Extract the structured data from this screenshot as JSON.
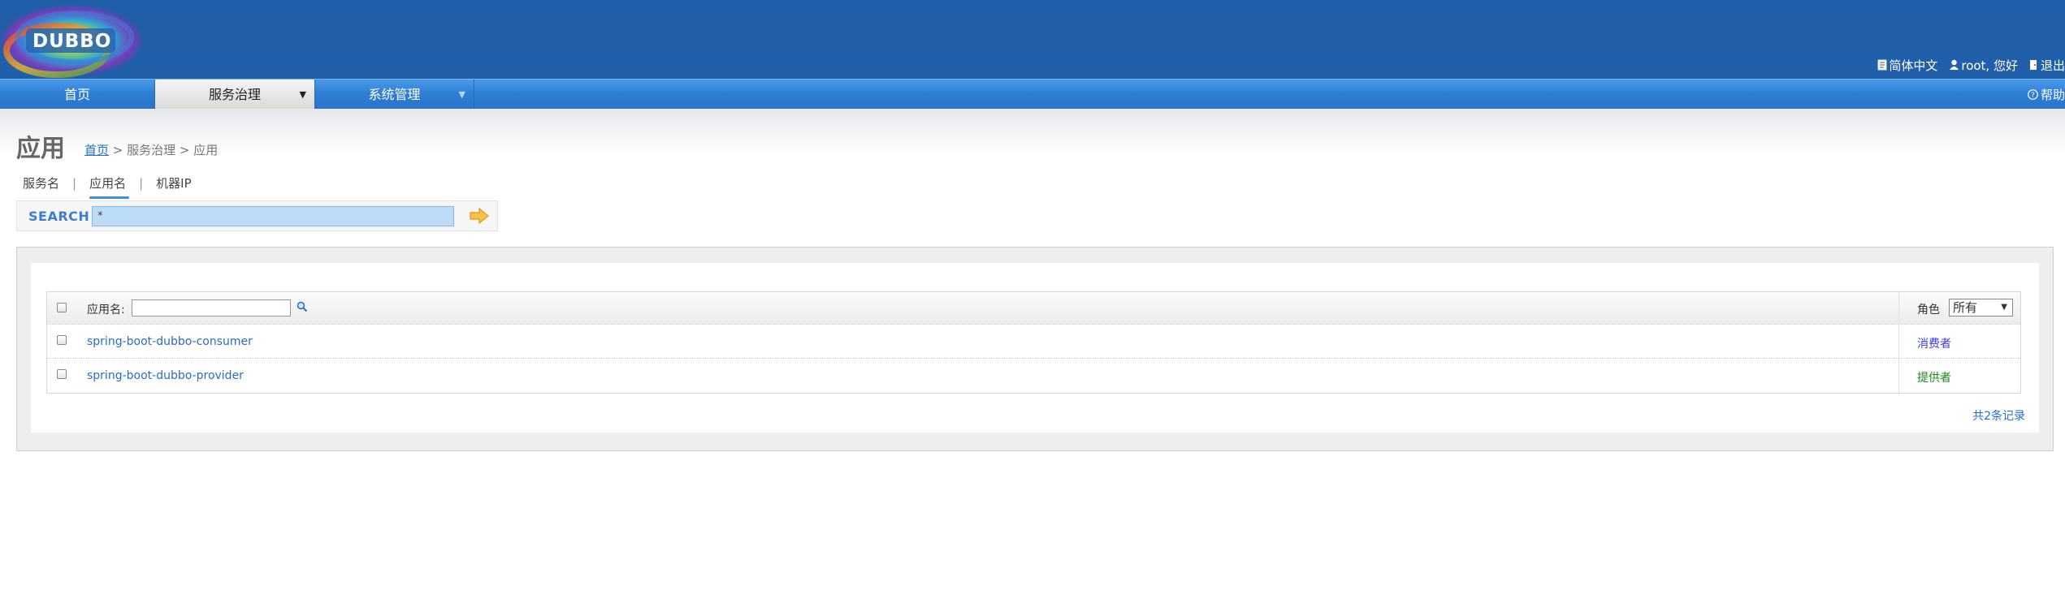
{
  "header": {
    "logo_text": "DUBBO",
    "top_links": [
      {
        "label": "简体中文",
        "icon": "document-icon"
      },
      {
        "label": "root, 您好",
        "icon": "user-icon"
      },
      {
        "label": "退出",
        "icon": "logout-icon"
      }
    ]
  },
  "menu": {
    "items": [
      {
        "label": "首页",
        "has_dropdown": false
      },
      {
        "label": "服务治理",
        "has_dropdown": true,
        "active": true
      },
      {
        "label": "系统管理",
        "has_dropdown": true
      }
    ],
    "dropdown_arrow": "▼",
    "help_label": "帮助",
    "help_icon": "help-icon"
  },
  "page": {
    "title": "应用",
    "breadcrumb": {
      "home": "首页",
      "trail": " > 服务治理 > 应用"
    }
  },
  "search": {
    "tabs": [
      "服务名",
      "应用名",
      "机器IP"
    ],
    "active_tab": 1,
    "label": "SEARCH",
    "value": "*",
    "go_icon": "arrow-right-icon"
  },
  "table": {
    "head_label": "应用名:",
    "filter_value": "",
    "filter_icon": "search-icon",
    "role_label": "角色",
    "role_selected": "所有",
    "rows": [
      {
        "app": "spring-boot-dubbo-consumer",
        "role": "消费者",
        "role_color": "#3a3ae0"
      },
      {
        "app": "spring-boot-dubbo-provider",
        "role": "提供者",
        "role_color": "#1a8a1a"
      }
    ],
    "records": "共2条记录"
  },
  "colors": {
    "header_bg": "#1f5ea8",
    "menu_bg": "#2f7fd6",
    "link": "#2a6cc4",
    "search_label": "#3b7fd0"
  }
}
